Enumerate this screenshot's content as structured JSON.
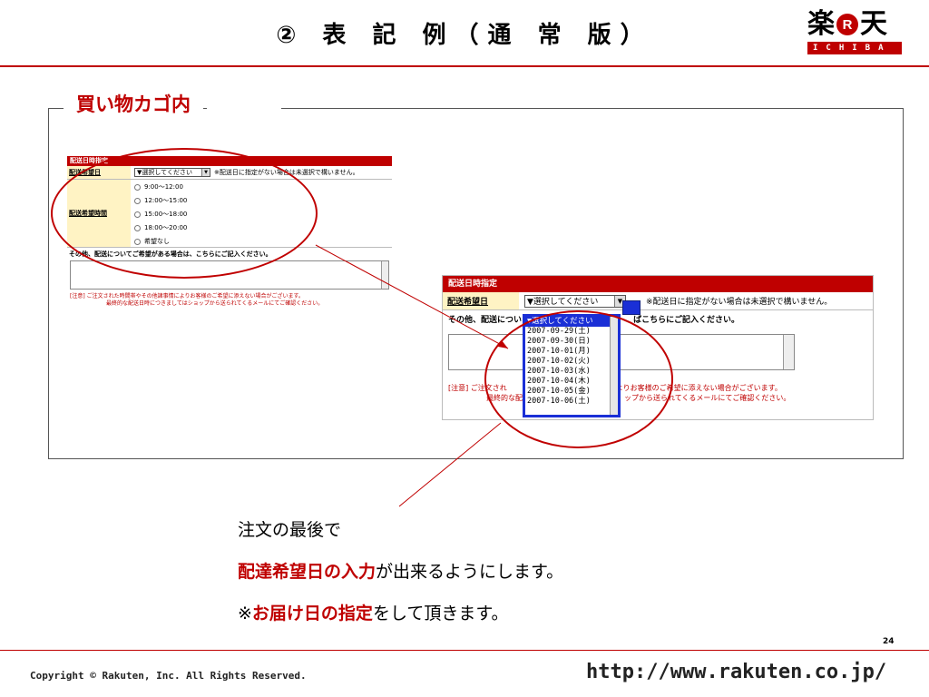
{
  "header": {
    "title": "② 表 記 例（通 常 版）",
    "logo_kanji_left": "楽",
    "logo_r": "R",
    "logo_kanji_right": "天",
    "logo_sub": "ICHIBA"
  },
  "section_label": "買い物カゴ内",
  "form_small": {
    "header": "配送日時指定",
    "date_label": "配送希望日",
    "date_select": "▼選択してください",
    "date_hint": "※配送日に指定がない場合は未選択で構いません。",
    "time_label": "配送希望時間",
    "time_options": [
      "9:00〜12:00",
      "12:00〜15:00",
      "15:00〜18:00",
      "18:00〜20:00",
      "希望なし"
    ],
    "other_label": "その他、配送についてご希望がある場合は、こちらにご記入ください。",
    "note_line1": "[注意] ご注文された時間帯やその他諸事情によりお客様のご希望に添えない場合がございます。",
    "note_line2": "最終的な配送日時につきましてはショップから送られてくるメールにてご確認ください。"
  },
  "form_large": {
    "header": "配送日時指定",
    "date_label": "配送希望日",
    "date_select": "▼選択してください",
    "date_hint": "※配送日に指定がない場合は未選択で構いません。",
    "other_left": "その他、配送につい",
    "other_right": "ばこちらにご記入ください。",
    "note_left1": "[注意] ご注文され",
    "note_right1": "によりお客様のご希望に添えない場合がございます。",
    "note_left2": "最終的な配",
    "note_right2": "ップから送られてくるメールにてご確認ください。",
    "dropdown_options": [
      "▼選択してください",
      "2007-09-29(土)",
      "2007-09-30(日)",
      "2007-10-01(月)",
      "2007-10-02(火)",
      "2007-10-03(水)",
      "2007-10-04(木)",
      "2007-10-05(金)",
      "2007-10-06(土)"
    ]
  },
  "body": {
    "line1": "注文の最後で",
    "line2_red": "配達希望日の入力",
    "line2_rest": "が出来るようにします。",
    "line3_prefix": "※",
    "line3_red": "お届け日の指定",
    "line3_rest": "をして頂きます。"
  },
  "footer": {
    "page_number": "24",
    "copyright": "Copyright © Rakuten, Inc. All Rights Reserved.",
    "url": "http://www.rakuten.co.jp/"
  },
  "colors": {
    "brand_red": "#bf0000",
    "highlight_blue": "#1a2fd6",
    "label_yellow": "#fff3c4"
  }
}
